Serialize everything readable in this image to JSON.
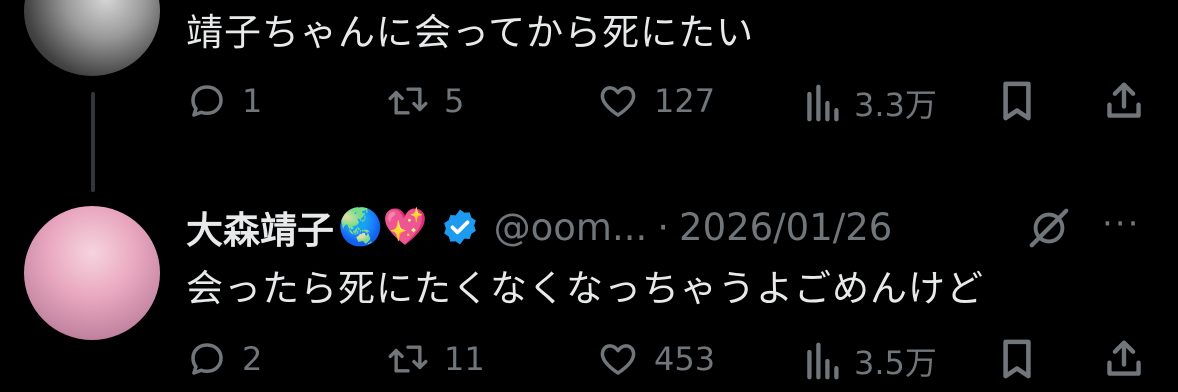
{
  "tweets": [
    {
      "text": "靖子ちゃんに会ってから死にたい",
      "replies": "1",
      "reposts": "5",
      "likes": "127",
      "views": "3.3万"
    },
    {
      "author": "大森靖子",
      "author_emojis": "🌏💖",
      "handle": "@oom...",
      "separator": "·",
      "date": "2026/01/26",
      "text": "会ったら死にたくなくなっちゃうよごめんけど",
      "replies": "2",
      "reposts": "11",
      "likes": "453",
      "views": "3.5万"
    }
  ],
  "more_label": "···",
  "colors": {
    "background": "#000000",
    "text": "#e7e9ea",
    "muted": "#71767b",
    "verified": "#1d9bf0"
  },
  "icons": [
    "reply-icon",
    "repost-icon",
    "like-icon",
    "views-icon",
    "bookmark-icon",
    "share-icon",
    "grok-icon",
    "more-icon",
    "verified-badge-icon"
  ]
}
